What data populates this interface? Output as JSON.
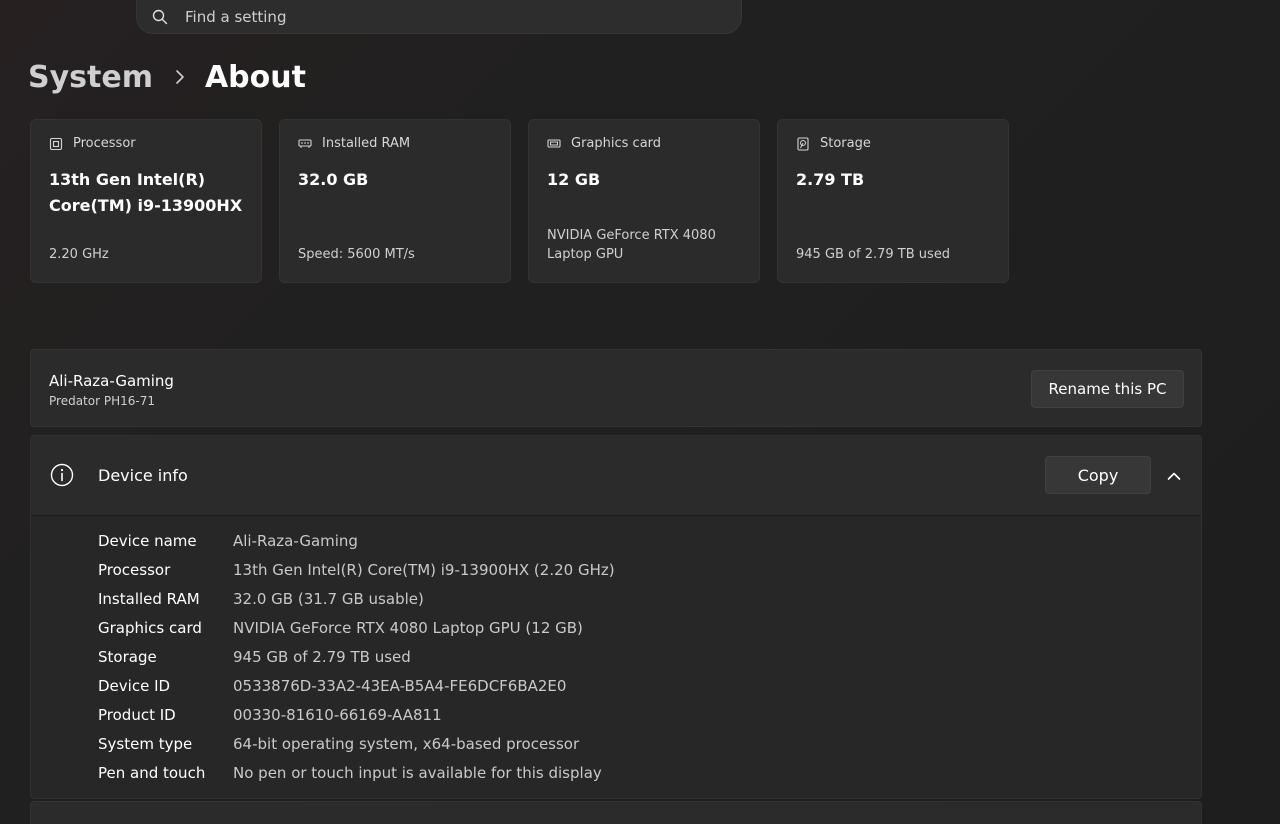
{
  "search": {
    "placeholder": "Find a setting"
  },
  "breadcrumb": {
    "parent": "System",
    "current": "About"
  },
  "cards": [
    {
      "title": "Processor",
      "icon": "processor-icon",
      "value": "13th Gen Intel(R) Core(TM) i9-13900HX",
      "sub": "2.20 GHz"
    },
    {
      "title": "Installed RAM",
      "icon": "ram-icon",
      "value": "32.0 GB",
      "sub": "Speed: 5600 MT/s"
    },
    {
      "title": "Graphics card",
      "icon": "graphics-card-icon",
      "value": "12 GB",
      "sub": "NVIDIA GeForce RTX 4080 Laptop GPU"
    },
    {
      "title": "Storage",
      "icon": "storage-icon",
      "value": "2.79 TB",
      "sub": "945 GB of 2.79 TB used"
    }
  ],
  "pc": {
    "name": "Ali-Raza-Gaming",
    "model": "Predator PH16-71",
    "rename_label": "Rename this PC"
  },
  "device_info": {
    "title": "Device info",
    "copy_label": "Copy",
    "specs": [
      {
        "key": "Device name",
        "value": "Ali-Raza-Gaming"
      },
      {
        "key": "Processor",
        "value": "13th Gen Intel(R) Core(TM) i9-13900HX (2.20 GHz)"
      },
      {
        "key": "Installed RAM",
        "value": "32.0 GB (31.7 GB usable)"
      },
      {
        "key": "Graphics card",
        "value": "NVIDIA GeForce RTX 4080 Laptop GPU (12 GB)"
      },
      {
        "key": "Storage",
        "value": "945 GB of 2.79 TB used"
      },
      {
        "key": "Device ID",
        "value": "0533876D-33A2-43EA-B5A4-FE6DCF6BA2E0"
      },
      {
        "key": "Product ID",
        "value": "00330-81610-66169-AA811"
      },
      {
        "key": "System type",
        "value": "64-bit operating system, x64-based processor"
      },
      {
        "key": "Pen and touch",
        "value": "No pen or touch input is available for this display"
      }
    ]
  },
  "colors": {
    "background": "#202020",
    "card": "#2b2b2b",
    "button": "#373737",
    "text_primary": "#ffffff",
    "text_secondary": "#c9c9c9"
  }
}
